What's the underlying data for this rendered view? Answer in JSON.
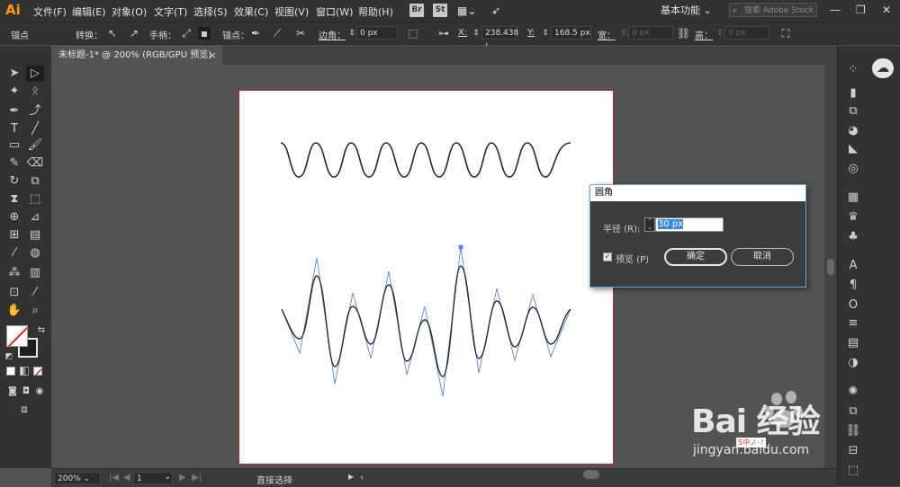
{
  "menubar": {
    "app_logo": "Ai",
    "menus": [
      "文件(F)",
      "编辑(E)",
      "对象(O)",
      "文字(T)",
      "选择(S)",
      "效果(C)",
      "视图(V)",
      "窗口(W)",
      "帮助(H)"
    ],
    "bridge_badge": "Br",
    "stock_badge": "St",
    "workspace": "基本功能",
    "stock_search_placeholder": "搜索 Adobe Stock"
  },
  "controlbar": {
    "selection_label": "锚点",
    "convert_label": "转换：",
    "handle_label": "手柄：",
    "anchor_label": "锚点：",
    "corner_label": "边角：",
    "corner_value": "0 px",
    "x_label": "X:",
    "x_value": "238.438 !",
    "y_label": "Y:",
    "y_value": "168.5 px",
    "width_label": "宽：",
    "width_value": "0 px",
    "height_label": "高：",
    "height_value": "0 px"
  },
  "document_tab": {
    "title": "未标题-1* @ 200% (RGB/GPU 预览)",
    "close": "×"
  },
  "statusbar": {
    "zoom": "200%",
    "page": "1",
    "tool_name": "直接选择"
  },
  "dialog": {
    "title": "圆角",
    "radius_label": "半径 (R):",
    "radius_value": "30 px",
    "preview_label": "预览 (P)",
    "preview_checked": true,
    "ok_label": "确定",
    "cancel_label": "取消"
  },
  "watermark": {
    "text": "Bai 经验",
    "sub": "jingyan.baidu.com",
    "brand": "S中ノ·♪"
  },
  "colors": {
    "accent": "#ff9a00",
    "artboard_border": "#b5282f",
    "path_selection": "#4f7fe0",
    "dialog_border": "#6fa0d6"
  }
}
